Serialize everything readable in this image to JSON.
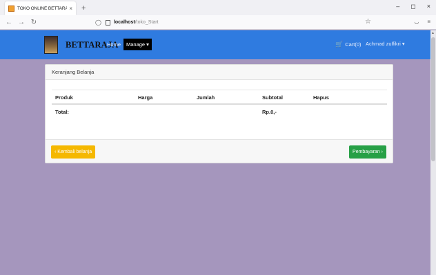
{
  "browser": {
    "tab_title": "TOKO ONLINE BETTARAJA",
    "tab_close": "×",
    "new_tab": "+",
    "url_host": "localhost",
    "url_path": "/toko_Start",
    "win_min": "–",
    "win_max": "◻",
    "win_close": "×"
  },
  "app_nav": {
    "brand": "BETTARAJA",
    "home": "Home",
    "manage": "Manage ▾",
    "cart": "Cart(0)",
    "user": "Achmad zulfikri ▾"
  },
  "card": {
    "header": "Keranjang Belanja",
    "columns": [
      "Produk",
      "Harga",
      "Jumlah",
      "Subtotal",
      "Hapus"
    ],
    "total_label": "Total:",
    "total_value": "Rp.0,-",
    "back_button": "‹ Kembali belanja",
    "pay_button": "Pembayaran ›"
  },
  "colors": {
    "nav_blue": "#2f7be0",
    "page_bg": "#a596bd",
    "back_yellow": "#f5b800",
    "pay_green": "#27a046"
  }
}
